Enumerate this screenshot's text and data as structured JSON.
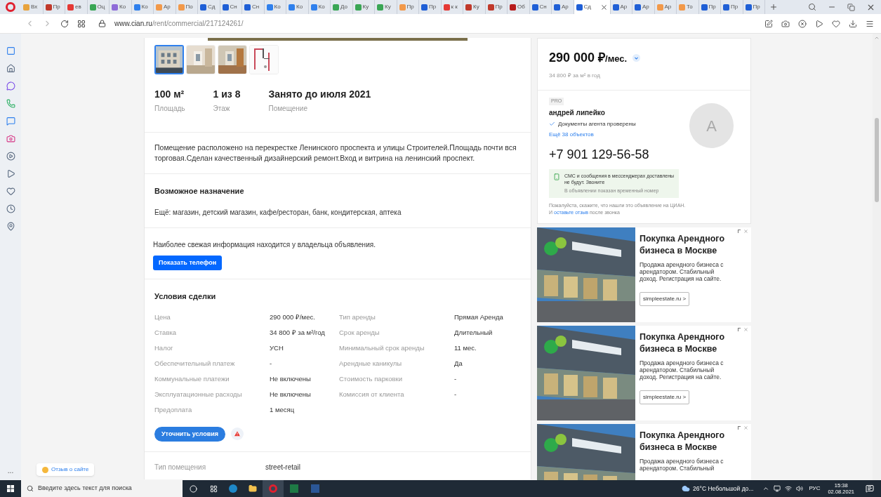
{
  "browser": {
    "tabs": [
      {
        "label": "Вх",
        "color": "#e8a33d",
        "selected": false
      },
      {
        "label": "Пр",
        "color": "#c0392b",
        "selected": false
      },
      {
        "label": "ев",
        "color": "#e53935",
        "selected": false
      },
      {
        "label": "Оц",
        "color": "#3aa655",
        "selected": false
      },
      {
        "label": "Ко",
        "color": "#8e6bd8",
        "selected": false
      },
      {
        "label": "Ко",
        "color": "#2f80ed",
        "selected": false
      },
      {
        "label": "Ар",
        "color": "#f2994a",
        "selected": false
      },
      {
        "label": "По",
        "color": "#f2994a",
        "selected": false
      },
      {
        "label": "Сд",
        "color": "#1f5fd6",
        "selected": false
      },
      {
        "label": "Сн",
        "color": "#1f5fd6",
        "selected": false
      },
      {
        "label": "Сн",
        "color": "#1f5fd6",
        "selected": false
      },
      {
        "label": "Ко",
        "color": "#2f80ed",
        "selected": false
      },
      {
        "label": "Ко",
        "color": "#2f80ed",
        "selected": false
      },
      {
        "label": "Ко",
        "color": "#2f80ed",
        "selected": false
      },
      {
        "label": "До",
        "color": "#3aa655",
        "selected": false
      },
      {
        "label": "Ку",
        "color": "#3aa655",
        "selected": false
      },
      {
        "label": "Ку",
        "color": "#3aa655",
        "selected": false
      },
      {
        "label": "Пр",
        "color": "#f2994a",
        "selected": false
      },
      {
        "label": "Пр",
        "color": "#1f5fd6",
        "selected": false
      },
      {
        "label": "к к",
        "color": "#e53935",
        "selected": false
      },
      {
        "label": "Ку",
        "color": "#c0392b",
        "selected": false
      },
      {
        "label": "Пр",
        "color": "#c0392b",
        "selected": false
      },
      {
        "label": "Об",
        "color": "#b71c1c",
        "selected": false
      },
      {
        "label": "Сн",
        "color": "#1f5fd6",
        "selected": false
      },
      {
        "label": "Ар",
        "color": "#1f5fd6",
        "selected": false
      },
      {
        "label": "Сд",
        "color": "#1f5fd6",
        "selected": true
      },
      {
        "label": "Ар",
        "color": "#1f5fd6",
        "selected": false
      },
      {
        "label": "Ар",
        "color": "#1f5fd6",
        "selected": false
      },
      {
        "label": "Ар",
        "color": "#f2994a",
        "selected": false
      },
      {
        "label": "То",
        "color": "#f2994a",
        "selected": false
      },
      {
        "label": "Пр",
        "color": "#1f5fd6",
        "selected": false
      },
      {
        "label": "Пр",
        "color": "#1f5fd6",
        "selected": false
      },
      {
        "label": "Пр",
        "color": "#1f5fd6",
        "selected": false
      }
    ],
    "address": {
      "host": "www.cian.ru",
      "path": "/rent/commercial/217124261/"
    }
  },
  "sidebar": {
    "more": "..."
  },
  "listing": {
    "thumbnails": [
      {
        "kind": "picture",
        "selected": true
      },
      {
        "kind": "picture",
        "selected": false
      },
      {
        "kind": "picture",
        "selected": false
      },
      {
        "kind": "picture",
        "selected": false
      }
    ],
    "stats": [
      {
        "value": "100 м²",
        "label": "Площадь"
      },
      {
        "value": "1 из 8",
        "label": "Этаж"
      },
      {
        "value": "Занято до июля 2021",
        "label": "Помещение"
      }
    ],
    "description": "Помещение расположено на перекрестке Ленинского проспекта и улицы Строителей.Площадь почти вся торговая.Сделан качественный дизайнерский ремонт.Вход и витрина на ленинский проспект.",
    "purpose": {
      "title": "Возможное назначение",
      "text": "Ещё: магазин, детский магазин, кафе/ресторан, банк, кондитерская, аптека"
    },
    "contact": {
      "text": "Наиболее свежая информация находится у владельца объявления.",
      "button": "Показать телефон"
    },
    "deal": {
      "title": "Условия сделки",
      "rows": [
        {
          "label": "Цена",
          "value": "290 000 ₽/мес.",
          "label_2": "Тип аренды",
          "value_2": "Прямая Аренда"
        },
        {
          "label": "Ставка",
          "value": "34 800 ₽ за м²/год",
          "label_2": "Срок аренды",
          "value_2": "Длительный"
        },
        {
          "label": "Налог",
          "value": "УСН",
          "label_2": "Минимальный срок аренды",
          "value_2": "11 мес."
        },
        {
          "label": "Обеспечительный платеж",
          "value": "-",
          "label_2": "Арендные каникулы",
          "value_2": "Да"
        },
        {
          "label": "Коммунальные платежи",
          "value": "Не включены",
          "label_2": "Стоимость парковки",
          "value_2": "-"
        },
        {
          "label": "Эксплуатационные расходы",
          "value": "Не включены",
          "label_2": "Комиссия от клиента",
          "value_2": "-"
        },
        {
          "label": "Предоплата",
          "value": "1 месяц"
        }
      ],
      "button": "Уточнить условия"
    },
    "details": [
      {
        "label": "Тип помещения",
        "value": "street-retail"
      }
    ]
  },
  "price": {
    "value": "290 000 ₽",
    "unit": "/мес.",
    "per_m2": "34 800 ₽ за м² в год"
  },
  "agent": {
    "badge": "PRO",
    "name": "андрей липейко",
    "verified": "Документы агента проверены",
    "more_link": "Ещё 38 объектов",
    "avatar_letter": "A",
    "phone": "+7 901 129-56-58",
    "notice": {
      "title": "СМС и сообщения в мессенджерах доставлены не будут. Звоните",
      "note": "В объявлении показан временный номер"
    },
    "feedback": {
      "before": "Пожалуйста, скажите, что нашли это объявление на ЦИАН. И",
      "link": "оставьте отзыв",
      "after": "после звонка"
    }
  },
  "ads": [
    {
      "title": "Покупка Арендного бизнеса в Москве",
      "text": "Продажа арендного бизнеса с арендатором. Стабильный доход. Регистрация на сайте.",
      "button": "simpleestate.ru >"
    },
    {
      "title": "Покупка Арендного бизнеса в Москве",
      "text": "Продажа арендного бизнеса с арендатором. Стабильный доход. Регистрация на сайте.",
      "button": "simpleestate.ru >"
    },
    {
      "title": "Покупка Арендного бизнеса в Москве",
      "text": "Продажа арендного бизнеса с арендатором. Стабильный"
    }
  ],
  "feedback_button": "Отзыв о сайте",
  "taskbar": {
    "search_placeholder": "Введите здесь текст для поиска",
    "weather": "26°C Небольшой до...",
    "language": "РУС",
    "time": "15:38",
    "date": "02.08.2021"
  }
}
